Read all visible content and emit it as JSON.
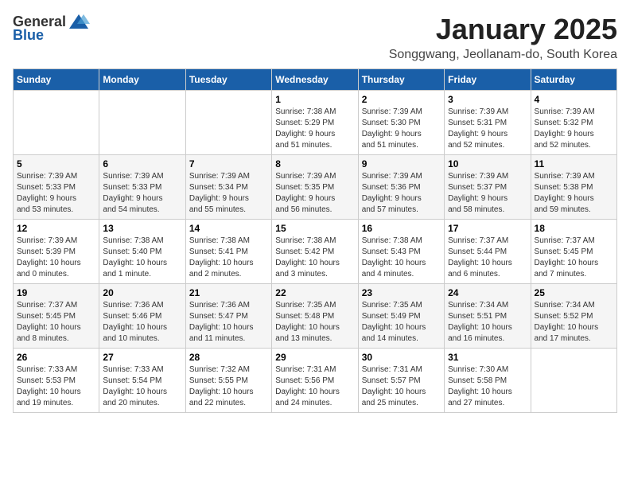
{
  "logo": {
    "general": "General",
    "blue": "Blue"
  },
  "title": "January 2025",
  "location": "Songgwang, Jeollanam-do, South Korea",
  "headers": [
    "Sunday",
    "Monday",
    "Tuesday",
    "Wednesday",
    "Thursday",
    "Friday",
    "Saturday"
  ],
  "weeks": [
    [
      {
        "day": "",
        "info": ""
      },
      {
        "day": "",
        "info": ""
      },
      {
        "day": "",
        "info": ""
      },
      {
        "day": "1",
        "info": "Sunrise: 7:38 AM\nSunset: 5:29 PM\nDaylight: 9 hours\nand 51 minutes."
      },
      {
        "day": "2",
        "info": "Sunrise: 7:39 AM\nSunset: 5:30 PM\nDaylight: 9 hours\nand 51 minutes."
      },
      {
        "day": "3",
        "info": "Sunrise: 7:39 AM\nSunset: 5:31 PM\nDaylight: 9 hours\nand 52 minutes."
      },
      {
        "day": "4",
        "info": "Sunrise: 7:39 AM\nSunset: 5:32 PM\nDaylight: 9 hours\nand 52 minutes."
      }
    ],
    [
      {
        "day": "5",
        "info": "Sunrise: 7:39 AM\nSunset: 5:33 PM\nDaylight: 9 hours\nand 53 minutes."
      },
      {
        "day": "6",
        "info": "Sunrise: 7:39 AM\nSunset: 5:33 PM\nDaylight: 9 hours\nand 54 minutes."
      },
      {
        "day": "7",
        "info": "Sunrise: 7:39 AM\nSunset: 5:34 PM\nDaylight: 9 hours\nand 55 minutes."
      },
      {
        "day": "8",
        "info": "Sunrise: 7:39 AM\nSunset: 5:35 PM\nDaylight: 9 hours\nand 56 minutes."
      },
      {
        "day": "9",
        "info": "Sunrise: 7:39 AM\nSunset: 5:36 PM\nDaylight: 9 hours\nand 57 minutes."
      },
      {
        "day": "10",
        "info": "Sunrise: 7:39 AM\nSunset: 5:37 PM\nDaylight: 9 hours\nand 58 minutes."
      },
      {
        "day": "11",
        "info": "Sunrise: 7:39 AM\nSunset: 5:38 PM\nDaylight: 9 hours\nand 59 minutes."
      }
    ],
    [
      {
        "day": "12",
        "info": "Sunrise: 7:39 AM\nSunset: 5:39 PM\nDaylight: 10 hours\nand 0 minutes."
      },
      {
        "day": "13",
        "info": "Sunrise: 7:38 AM\nSunset: 5:40 PM\nDaylight: 10 hours\nand 1 minute."
      },
      {
        "day": "14",
        "info": "Sunrise: 7:38 AM\nSunset: 5:41 PM\nDaylight: 10 hours\nand 2 minutes."
      },
      {
        "day": "15",
        "info": "Sunrise: 7:38 AM\nSunset: 5:42 PM\nDaylight: 10 hours\nand 3 minutes."
      },
      {
        "day": "16",
        "info": "Sunrise: 7:38 AM\nSunset: 5:43 PM\nDaylight: 10 hours\nand 4 minutes."
      },
      {
        "day": "17",
        "info": "Sunrise: 7:37 AM\nSunset: 5:44 PM\nDaylight: 10 hours\nand 6 minutes."
      },
      {
        "day": "18",
        "info": "Sunrise: 7:37 AM\nSunset: 5:45 PM\nDaylight: 10 hours\nand 7 minutes."
      }
    ],
    [
      {
        "day": "19",
        "info": "Sunrise: 7:37 AM\nSunset: 5:45 PM\nDaylight: 10 hours\nand 8 minutes."
      },
      {
        "day": "20",
        "info": "Sunrise: 7:36 AM\nSunset: 5:46 PM\nDaylight: 10 hours\nand 10 minutes."
      },
      {
        "day": "21",
        "info": "Sunrise: 7:36 AM\nSunset: 5:47 PM\nDaylight: 10 hours\nand 11 minutes."
      },
      {
        "day": "22",
        "info": "Sunrise: 7:35 AM\nSunset: 5:48 PM\nDaylight: 10 hours\nand 13 minutes."
      },
      {
        "day": "23",
        "info": "Sunrise: 7:35 AM\nSunset: 5:49 PM\nDaylight: 10 hours\nand 14 minutes."
      },
      {
        "day": "24",
        "info": "Sunrise: 7:34 AM\nSunset: 5:51 PM\nDaylight: 10 hours\nand 16 minutes."
      },
      {
        "day": "25",
        "info": "Sunrise: 7:34 AM\nSunset: 5:52 PM\nDaylight: 10 hours\nand 17 minutes."
      }
    ],
    [
      {
        "day": "26",
        "info": "Sunrise: 7:33 AM\nSunset: 5:53 PM\nDaylight: 10 hours\nand 19 minutes."
      },
      {
        "day": "27",
        "info": "Sunrise: 7:33 AM\nSunset: 5:54 PM\nDaylight: 10 hours\nand 20 minutes."
      },
      {
        "day": "28",
        "info": "Sunrise: 7:32 AM\nSunset: 5:55 PM\nDaylight: 10 hours\nand 22 minutes."
      },
      {
        "day": "29",
        "info": "Sunrise: 7:31 AM\nSunset: 5:56 PM\nDaylight: 10 hours\nand 24 minutes."
      },
      {
        "day": "30",
        "info": "Sunrise: 7:31 AM\nSunset: 5:57 PM\nDaylight: 10 hours\nand 25 minutes."
      },
      {
        "day": "31",
        "info": "Sunrise: 7:30 AM\nSunset: 5:58 PM\nDaylight: 10 hours\nand 27 minutes."
      },
      {
        "day": "",
        "info": ""
      }
    ]
  ]
}
